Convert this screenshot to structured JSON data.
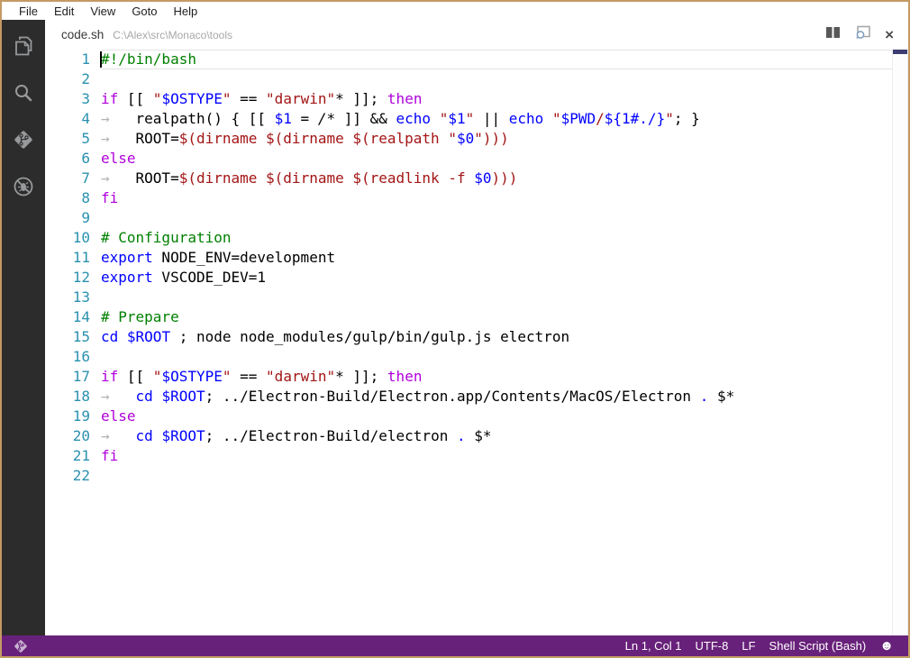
{
  "menu": {
    "items": [
      "File",
      "Edit",
      "View",
      "Goto",
      "Help"
    ]
  },
  "activity_bar": {
    "icons": [
      "files-icon",
      "search-icon",
      "git-icon",
      "debug-icon"
    ]
  },
  "tab": {
    "filename": "code.sh",
    "path": "C:\\Alex\\src\\Monaco\\tools"
  },
  "editor": {
    "language": "Shell Script (Bash)",
    "cursor": {
      "line": 1,
      "col": 1
    },
    "lines": [
      [
        {
          "t": "#!/bin/bash",
          "c": "comment"
        }
      ],
      [],
      [
        {
          "t": "if",
          "c": "kw"
        },
        {
          "t": " [[ ",
          "c": "def"
        },
        {
          "t": "\"",
          "c": "str"
        },
        {
          "t": "$OSTYPE",
          "c": "var"
        },
        {
          "t": "\"",
          "c": "str"
        },
        {
          "t": " == ",
          "c": "def"
        },
        {
          "t": "\"darwin\"",
          "c": "str"
        },
        {
          "t": "*",
          "c": "glob"
        },
        {
          "t": " ]]; ",
          "c": "def"
        },
        {
          "t": "then",
          "c": "kw"
        }
      ],
      [
        {
          "t": "→",
          "c": "tab"
        },
        {
          "t": "realpath() { [[ ",
          "c": "def"
        },
        {
          "t": "$1",
          "c": "var"
        },
        {
          "t": " = ",
          "c": "def"
        },
        {
          "t": "/*",
          "c": "glob"
        },
        {
          "t": " ]] && ",
          "c": "def"
        },
        {
          "t": "echo",
          "c": "var"
        },
        {
          "t": " ",
          "c": "def"
        },
        {
          "t": "\"",
          "c": "str"
        },
        {
          "t": "$1",
          "c": "var"
        },
        {
          "t": "\"",
          "c": "str"
        },
        {
          "t": " || ",
          "c": "def"
        },
        {
          "t": "echo",
          "c": "var"
        },
        {
          "t": " ",
          "c": "def"
        },
        {
          "t": "\"",
          "c": "str"
        },
        {
          "t": "$PWD",
          "c": "var"
        },
        {
          "t": "/",
          "c": "str"
        },
        {
          "t": "${1#./}",
          "c": "var"
        },
        {
          "t": "\"",
          "c": "str"
        },
        {
          "t": "; }",
          "c": "def"
        }
      ],
      [
        {
          "t": "→",
          "c": "tab"
        },
        {
          "t": "ROOT=",
          "c": "def"
        },
        {
          "t": "$(dirname $(dirname $(realpath \"",
          "c": "str"
        },
        {
          "t": "$0",
          "c": "var"
        },
        {
          "t": "\")))",
          "c": "str"
        }
      ],
      [
        {
          "t": "else",
          "c": "kw"
        }
      ],
      [
        {
          "t": "→",
          "c": "tab"
        },
        {
          "t": "ROOT=",
          "c": "def"
        },
        {
          "t": "$(dirname $(dirname $(readlink -f ",
          "c": "str"
        },
        {
          "t": "$0",
          "c": "var"
        },
        {
          "t": ")))",
          "c": "str"
        }
      ],
      [
        {
          "t": "fi",
          "c": "kw"
        }
      ],
      [],
      [
        {
          "t": "# Configuration",
          "c": "comment"
        }
      ],
      [
        {
          "t": "export",
          "c": "var"
        },
        {
          "t": " NODE_ENV=development",
          "c": "def"
        }
      ],
      [
        {
          "t": "export",
          "c": "var"
        },
        {
          "t": " VSCODE_DEV=1",
          "c": "def"
        }
      ],
      [],
      [
        {
          "t": "# Prepare",
          "c": "comment"
        }
      ],
      [
        {
          "t": "cd",
          "c": "var"
        },
        {
          "t": " ",
          "c": "def"
        },
        {
          "t": "$ROOT",
          "c": "var"
        },
        {
          "t": " ; node node_modules/gulp/bin/gulp.js electron",
          "c": "def"
        }
      ],
      [],
      [
        {
          "t": "if",
          "c": "kw"
        },
        {
          "t": " [[ ",
          "c": "def"
        },
        {
          "t": "\"",
          "c": "str"
        },
        {
          "t": "$OSTYPE",
          "c": "var"
        },
        {
          "t": "\"",
          "c": "str"
        },
        {
          "t": " == ",
          "c": "def"
        },
        {
          "t": "\"darwin\"",
          "c": "str"
        },
        {
          "t": "*",
          "c": "glob"
        },
        {
          "t": " ]]; ",
          "c": "def"
        },
        {
          "t": "then",
          "c": "kw"
        }
      ],
      [
        {
          "t": "→",
          "c": "tab"
        },
        {
          "t": "cd",
          "c": "var"
        },
        {
          "t": " ",
          "c": "def"
        },
        {
          "t": "$ROOT",
          "c": "var"
        },
        {
          "t": "; ../Electron-Build/Electron.app/Contents/MacOS/Electron ",
          "c": "def"
        },
        {
          "t": ".",
          "c": "var"
        },
        {
          "t": " $*",
          "c": "def"
        }
      ],
      [
        {
          "t": "else",
          "c": "kw"
        }
      ],
      [
        {
          "t": "→",
          "c": "tab"
        },
        {
          "t": "cd",
          "c": "var"
        },
        {
          "t": " ",
          "c": "def"
        },
        {
          "t": "$ROOT",
          "c": "var"
        },
        {
          "t": "; ../Electron-Build/electron ",
          "c": "def"
        },
        {
          "t": ".",
          "c": "var"
        },
        {
          "t": " $*",
          "c": "def"
        }
      ],
      [
        {
          "t": "fi",
          "c": "kw"
        }
      ],
      []
    ]
  },
  "status_bar": {
    "items": [
      "Ln 1, Col 1",
      "UTF-8",
      "LF",
      "Shell Script (Bash)"
    ],
    "feedback_icon": "smiley"
  },
  "colors": {
    "keyword": "#af00db",
    "string": "#a31515",
    "variable": "#0000ff",
    "comment": "#008000",
    "line_number": "#2b91af",
    "status_bar_bg": "#68217a",
    "activity_bar_bg": "#2c2c2c",
    "window_border": "#c49a63",
    "overview_mark": "#3d3d73"
  }
}
